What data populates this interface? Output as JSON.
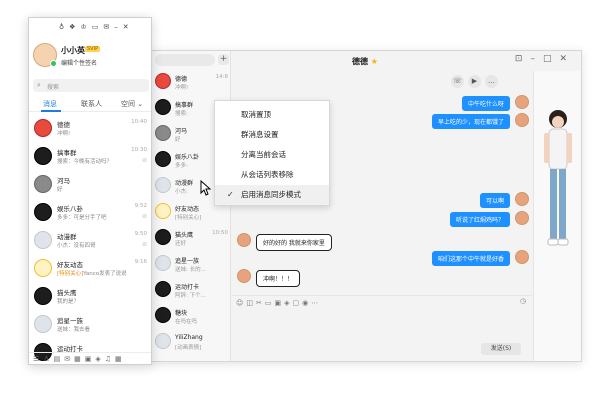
{
  "chat_window": {
    "title": "德德",
    "mini_list": [
      {
        "name": "德德",
        "preview": "冲啊!",
        "time": "14:8",
        "avatar": "av-red"
      },
      {
        "name": "搞事群",
        "preview": "搜索:",
        "time": "10:",
        "avatar": "av-penguin"
      },
      {
        "name": "河马",
        "preview": "好",
        "time": "",
        "avatar": "av-grey"
      },
      {
        "name": "娱乐八卦",
        "preview": "多多:",
        "time": "",
        "avatar": "av-penguin"
      },
      {
        "name": "动漫群",
        "preview": "小杰:",
        "time": "",
        "avatar": "av-light"
      },
      {
        "name": "好友动态",
        "preview": "[特别关心]",
        "time": "",
        "avatar": "av-star"
      },
      {
        "name": "猫头鹰",
        "preview": "还好",
        "time": "10:50",
        "avatar": "av-penguin"
      },
      {
        "name": "追星一族",
        "preview": "送妹: 长的...",
        "time": "",
        "avatar": "av-light"
      },
      {
        "name": "运动打卡",
        "preview": "阿辞: 下个...",
        "time": "",
        "avatar": "av-penguin"
      },
      {
        "name": "糖块",
        "preview": "在吗在吗",
        "time": "",
        "avatar": "av-penguin"
      },
      {
        "name": "YiliZhang",
        "preview": "[动画表情]",
        "time": "",
        "avatar": "av-light"
      }
    ],
    "messages": [
      {
        "side": "right",
        "text": "中午吃什么呀"
      },
      {
        "side": "right",
        "text": "早上吃的少，现在都饿了"
      },
      {
        "side": "right",
        "text": "可以啊"
      },
      {
        "side": "right",
        "text": "听说了红焖鸡吗？"
      },
      {
        "side": "left",
        "text": "好的好的 我就来你家里"
      },
      {
        "side": "right",
        "text": "咱们这那个中午就是好香"
      },
      {
        "side": "left",
        "text": "冲啊！！！"
      }
    ],
    "send_label": "发送(S)"
  },
  "context_menu": {
    "items": [
      {
        "label": "取消置顶",
        "checked": false
      },
      {
        "label": "群消息设置",
        "checked": false
      },
      {
        "label": "分离当前会话",
        "checked": false
      },
      {
        "label": "从会话列表移除",
        "checked": false
      },
      {
        "label": "启用消息同步模式",
        "checked": true
      }
    ]
  },
  "panel": {
    "username": "小小英",
    "vip": "SVIP",
    "signature": "编辑个性签名",
    "search_placeholder": "搜索",
    "tabs": [
      "消息",
      "联系人",
      "空间"
    ],
    "conversations": [
      {
        "name": "德德",
        "preview": "冲啊!",
        "highlight": "",
        "time": "10:40",
        "avatar": "av-red",
        "muted": false
      },
      {
        "name": "搞事群",
        "preview": "搜索：今晚有活动吗？",
        "highlight": "",
        "time": "10:30",
        "avatar": "av-penguin",
        "muted": true
      },
      {
        "name": "河马",
        "preview": "好",
        "highlight": "",
        "time": "",
        "avatar": "av-grey",
        "muted": false
      },
      {
        "name": "娱乐八卦",
        "preview": "多多：可是分手了吧",
        "highlight": "",
        "time": "9:52",
        "avatar": "av-penguin",
        "muted": true
      },
      {
        "name": "动漫群",
        "preview": "小杰：没有四哥",
        "highlight": "",
        "time": "9:50",
        "avatar": "av-light",
        "muted": true
      },
      {
        "name": "好友动态",
        "preview": "Yanco发表了说说",
        "highlight": "[特别关心]",
        "time": "9:16",
        "avatar": "av-star",
        "muted": false
      },
      {
        "name": "猫头鹰",
        "preview": "我的是？",
        "highlight": "",
        "time": "",
        "avatar": "av-penguin",
        "muted": false
      },
      {
        "name": "追星一族",
        "preview": "送妹：我去看",
        "highlight": "",
        "time": "",
        "avatar": "av-light",
        "muted": false
      },
      {
        "name": "运动打卡",
        "preview": "",
        "highlight": "",
        "time": "",
        "avatar": "av-penguin",
        "muted": false
      }
    ]
  }
}
